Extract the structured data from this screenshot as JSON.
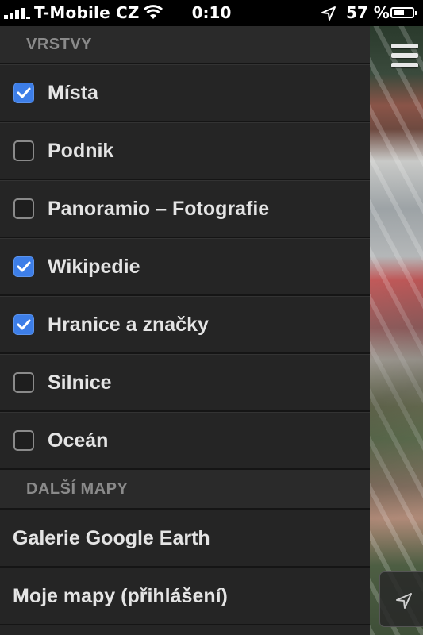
{
  "status_bar": {
    "carrier": "T-Mobile CZ",
    "time": "0:10",
    "battery_percent": "57 %",
    "battery_level": 0.57,
    "icons": [
      "signal-icon",
      "wifi-icon",
      "location-arrow-icon",
      "battery-icon"
    ]
  },
  "panel": {
    "layers_header": "VRSTVY",
    "layers": [
      {
        "label": "Místa",
        "checked": true
      },
      {
        "label": "Podnik",
        "checked": false
      },
      {
        "label": "Panoramio – Fotografie",
        "checked": false
      },
      {
        "label": "Wikipedie",
        "checked": true
      },
      {
        "label": "Hranice a značky",
        "checked": true
      },
      {
        "label": "Silnice",
        "checked": false
      },
      {
        "label": "Oceán",
        "checked": false
      }
    ],
    "more_maps_header": "DALŠÍ MAPY",
    "more_maps": [
      {
        "label": "Galerie Google Earth"
      },
      {
        "label": "Moje mapy (přihlášení)"
      }
    ]
  },
  "map": {
    "menu_icon": "hamburger-menu-icon",
    "locate_icon": "location-arrow-icon"
  },
  "colors": {
    "checkbox_on": "#3d7ee8",
    "panel_bg": "#252525"
  }
}
